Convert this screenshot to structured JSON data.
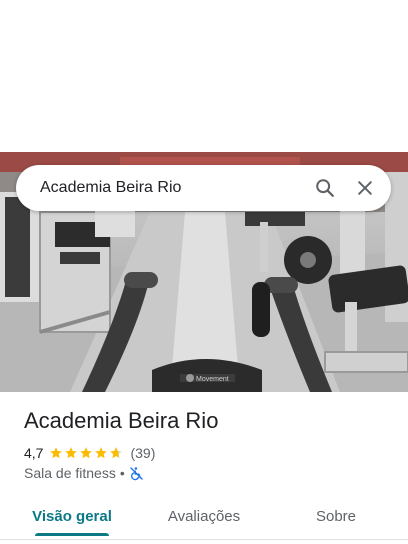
{
  "search": {
    "query": "Academia Beira Rio"
  },
  "place": {
    "name": "Academia Beira Rio",
    "rating": "4,7",
    "stars": 4.7,
    "review_count": "(39)",
    "category": "Sala de fitness",
    "separator": "•"
  },
  "photo": {
    "equipment_text": "Movement"
  },
  "tabs": [
    {
      "label": "Visão geral",
      "active": true
    },
    {
      "label": "Avaliações",
      "active": false
    },
    {
      "label": "Sobre",
      "active": false
    }
  ],
  "colors": {
    "accent": "#0b7a86",
    "star": "#fbbc04",
    "accessibility": "#1a73e8"
  },
  "icons": {
    "search": "search-icon",
    "close": "close-icon",
    "accessibility": "wheelchair-accessibility-icon"
  }
}
